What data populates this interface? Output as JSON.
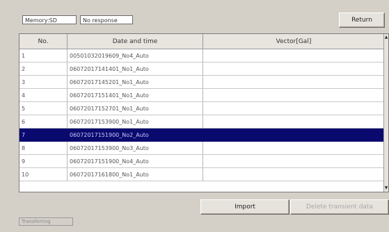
{
  "header": {
    "memory_tag": "Memory:SD",
    "status_tag": "No response",
    "return_label": "Return"
  },
  "table": {
    "columns": [
      "No.",
      "Date and time",
      "Vector[Gal]"
    ],
    "rows": [
      {
        "no": "1",
        "datetime": "00501032019609_No4_Auto",
        "vector": ""
      },
      {
        "no": "2",
        "datetime": "06072017141401_No1_Auto",
        "vector": ""
      },
      {
        "no": "3",
        "datetime": "06072017145201_No1_Auto",
        "vector": ""
      },
      {
        "no": "4",
        "datetime": "06072017151401_No1_Auto",
        "vector": ""
      },
      {
        "no": "5",
        "datetime": "06072017152701_No1_Auto",
        "vector": ""
      },
      {
        "no": "6",
        "datetime": "06072017153900_No1_Auto",
        "vector": ""
      },
      {
        "no": "7",
        "datetime": "06072017151900_No2_Auto",
        "vector": ""
      },
      {
        "no": "8",
        "datetime": "06072017153900_No3_Auto",
        "vector": ""
      },
      {
        "no": "9",
        "datetime": "06072017151900_No4_Auto",
        "vector": ""
      },
      {
        "no": "10",
        "datetime": "06072017161800_No1_Auto",
        "vector": ""
      }
    ],
    "selected_row": "7"
  },
  "footer": {
    "import_label": "Import",
    "delete_label": "Delete transient data",
    "status_text": "Transferring"
  }
}
